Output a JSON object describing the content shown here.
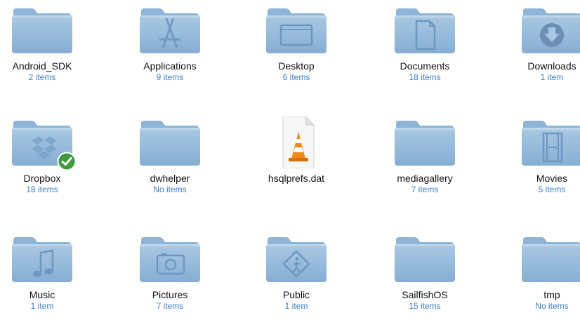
{
  "items": [
    {
      "name": "Android_SDK",
      "count": "2 items",
      "icon": "folder"
    },
    {
      "name": "Applications",
      "count": "9 items",
      "icon": "applications-folder"
    },
    {
      "name": "Desktop",
      "count": "6 items",
      "icon": "desktop-folder"
    },
    {
      "name": "Documents",
      "count": "18 items",
      "icon": "documents-folder"
    },
    {
      "name": "Downloads",
      "count": "1 item",
      "icon": "downloads-folder"
    },
    {
      "name": "Dropbox",
      "count": "18 items",
      "icon": "dropbox-folder"
    },
    {
      "name": "dwhelper",
      "count": "No items",
      "icon": "folder"
    },
    {
      "name": "hsqlprefs.dat",
      "count": "",
      "icon": "vlc-file"
    },
    {
      "name": "mediagallery",
      "count": "7 items",
      "icon": "folder"
    },
    {
      "name": "Movies",
      "count": "5 items",
      "icon": "movies-folder"
    },
    {
      "name": "Music",
      "count": "1 item",
      "icon": "music-folder"
    },
    {
      "name": "Pictures",
      "count": "7 items",
      "icon": "pictures-folder"
    },
    {
      "name": "Public",
      "count": "1 item",
      "icon": "public-folder"
    },
    {
      "name": "SailfishOS",
      "count": "15 items",
      "icon": "folder"
    },
    {
      "name": "tmp",
      "count": "No items",
      "icon": "folder"
    }
  ],
  "colors": {
    "folder_top": "#a9c8e3",
    "folder_bottom": "#86aed3",
    "folder_tab": "#8eb4d8",
    "count_text": "#3b7fd4"
  }
}
